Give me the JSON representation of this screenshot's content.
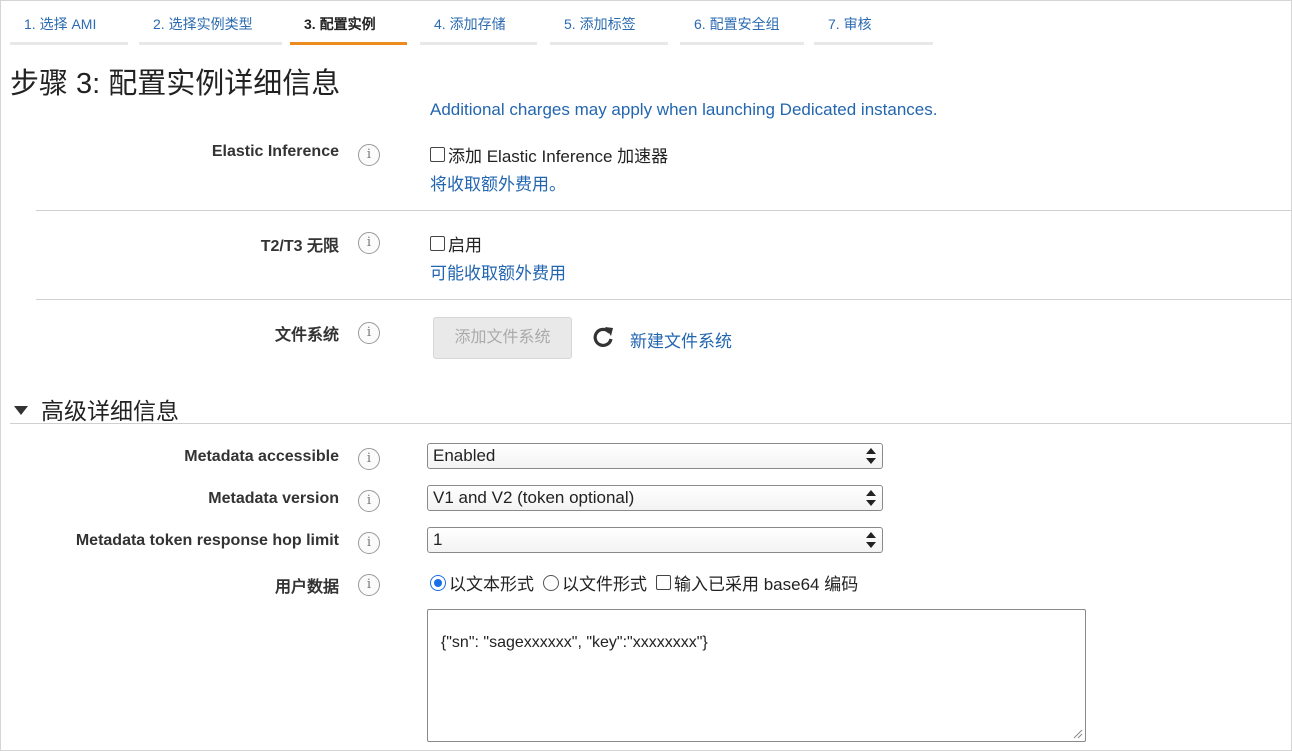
{
  "steps": [
    {
      "label": "1. 选择 AMI"
    },
    {
      "label": "2. 选择实例类型"
    },
    {
      "label": "3. 配置实例"
    },
    {
      "label": "4. 添加存储"
    },
    {
      "label": "5. 添加标签"
    },
    {
      "label": "6. 配置安全组"
    },
    {
      "label": "7. 审核"
    }
  ],
  "page_title": "步骤 3: 配置实例详细信息",
  "dedicated_note": "Additional charges may apply when launching Dedicated instances.",
  "elastic_inference": {
    "label": "Elastic Inference",
    "checkbox_label": "添加 Elastic Inference 加速器",
    "link": "将收取额外费用。"
  },
  "t2t3": {
    "label": "T2/T3 无限",
    "checkbox_label": "启用",
    "link": "可能收取额外费用"
  },
  "filesystem": {
    "label": "文件系统",
    "add_button": "添加文件系统",
    "new_link": "新建文件系统"
  },
  "advanced": {
    "title": "高级详细信息",
    "metadata_accessible": {
      "label": "Metadata accessible",
      "value": "Enabled"
    },
    "metadata_version": {
      "label": "Metadata version",
      "value": "V1 and V2 (token optional)"
    },
    "hop_limit": {
      "label": "Metadata token response hop limit",
      "value": "1"
    },
    "user_data": {
      "label": "用户数据",
      "option_text": "以文本形式",
      "option_file": "以文件形式",
      "base64_label": "输入已采用 base64 编码",
      "content": "{\"sn\": \"sagexxxxxx\", \"key\":\"xxxxxxxx\"}"
    }
  },
  "colors": {
    "link": "#2366b0",
    "active_tab": "#ec8b1e"
  }
}
